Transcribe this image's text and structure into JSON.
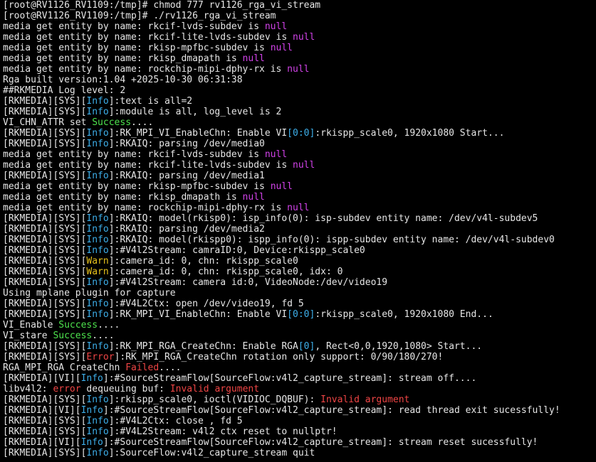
{
  "colors": {
    "background": "#000000",
    "text": "#e6e6e6",
    "info": "#3daee9",
    "null": "#d142e8",
    "success": "#4ee44e",
    "warn": "#e5c01c",
    "error": "#ef4545"
  },
  "lines": [
    [
      {
        "t": "[root@RV1126_RV1109:/tmp]# chmod 777 rv1126_rga_vi_stream"
      }
    ],
    [
      {
        "t": "[root@RV1126_RV1109:/tmp]# ./rv1126_rga_vi_stream"
      }
    ],
    [
      {
        "t": "media get entity by name: rkcif-lvds-subdev is "
      },
      {
        "t": "null",
        "c": "magenta"
      }
    ],
    [
      {
        "t": "media get entity by name: rkcif-lite-lvds-subdev is "
      },
      {
        "t": "null",
        "c": "magenta"
      }
    ],
    [
      {
        "t": "media get entity by name: rkisp-mpfbc-subdev is "
      },
      {
        "t": "null",
        "c": "magenta"
      }
    ],
    [
      {
        "t": "media get entity by name: rkisp_dmapath is "
      },
      {
        "t": "null",
        "c": "magenta"
      }
    ],
    [
      {
        "t": "media get entity by name: rockchip-mipi-dphy-rx is "
      },
      {
        "t": "null",
        "c": "magenta"
      }
    ],
    [
      {
        "t": "Rga built version:1.04 +2025-10-30 06:31:38"
      }
    ],
    [
      {
        "t": "##RKMEDIA Log level: 2"
      }
    ],
    [
      {
        "t": "[RKMEDIA][SYS]["
      },
      {
        "t": "Info",
        "c": "cyan"
      },
      {
        "t": "]:text is all=2"
      }
    ],
    [
      {
        "t": "[RKMEDIA][SYS]["
      },
      {
        "t": "Info",
        "c": "cyan"
      },
      {
        "t": "]:module is all, log_level is 2"
      }
    ],
    [
      {
        "t": "VI_CHN_ATTR set "
      },
      {
        "t": "Success",
        "c": "green"
      },
      {
        "t": "...."
      }
    ],
    [
      {
        "t": "[RKMEDIA][SYS]["
      },
      {
        "t": "Info",
        "c": "cyan"
      },
      {
        "t": "]:RK_MPI_VI_EnableChn: Enable VI"
      },
      {
        "t": "[0:0]",
        "c": "cyan"
      },
      {
        "t": ":rkispp_scale0, 1920x1080 Start..."
      }
    ],
    [
      {
        "t": "[RKMEDIA][SYS]["
      },
      {
        "t": "Info",
        "c": "cyan"
      },
      {
        "t": "]:RKAIQ: parsing /dev/media0"
      }
    ],
    [
      {
        "t": "media get entity by name: rkcif-lvds-subdev is "
      },
      {
        "t": "null",
        "c": "magenta"
      }
    ],
    [
      {
        "t": "media get entity by name: rkcif-lite-lvds-subdev is "
      },
      {
        "t": "null",
        "c": "magenta"
      }
    ],
    [
      {
        "t": "[RKMEDIA][SYS]["
      },
      {
        "t": "Info",
        "c": "cyan"
      },
      {
        "t": "]:RKAIQ: parsing /dev/media1"
      }
    ],
    [
      {
        "t": "media get entity by name: rkisp-mpfbc-subdev is "
      },
      {
        "t": "null",
        "c": "magenta"
      }
    ],
    [
      {
        "t": "media get entity by name: rkisp_dmapath is "
      },
      {
        "t": "null",
        "c": "magenta"
      }
    ],
    [
      {
        "t": "media get entity by name: rockchip-mipi-dphy-rx is "
      },
      {
        "t": "null",
        "c": "magenta"
      }
    ],
    [
      {
        "t": "[RKMEDIA][SYS]["
      },
      {
        "t": "Info",
        "c": "cyan"
      },
      {
        "t": "]:RKAIQ: model(rkisp0): isp_info(0): isp-subdev entity name: /dev/v4l-subdev5"
      }
    ],
    [
      {
        "t": "[RKMEDIA][SYS]["
      },
      {
        "t": "Info",
        "c": "cyan"
      },
      {
        "t": "]:RKAIQ: parsing /dev/media2"
      }
    ],
    [
      {
        "t": "[RKMEDIA][SYS]["
      },
      {
        "t": "Info",
        "c": "cyan"
      },
      {
        "t": "]:RKAIQ: model(rkispp0): ispp_info(0): ispp-subdev entity name: /dev/v4l-subdev0"
      }
    ],
    [
      {
        "t": "[RKMEDIA][SYS]["
      },
      {
        "t": "Info",
        "c": "cyan"
      },
      {
        "t": "]:#V4l2Stream: camraID:0, Device:rkispp_scale0"
      }
    ],
    [
      {
        "t": "[RKMEDIA][SYS]["
      },
      {
        "t": "Warn",
        "c": "yellow"
      },
      {
        "t": "]:camera_id: 0, chn: rkispp_scale0"
      }
    ],
    [
      {
        "t": "[RKMEDIA][SYS]["
      },
      {
        "t": "Warn",
        "c": "yellow"
      },
      {
        "t": "]:camera_id: 0, chn: rkispp_scale0, idx: 0"
      }
    ],
    [
      {
        "t": "[RKMEDIA][SYS]["
      },
      {
        "t": "Info",
        "c": "cyan"
      },
      {
        "t": "]:#V4l2Stream: camera id:0, VideoNode:/dev/video19"
      }
    ],
    [
      {
        "t": "Using mplane plugin for capture"
      }
    ],
    [
      {
        "t": "[RKMEDIA][SYS]["
      },
      {
        "t": "Info",
        "c": "cyan"
      },
      {
        "t": "]:#V4L2Ctx: open /dev/video19, fd 5"
      }
    ],
    [
      {
        "t": "[RKMEDIA][SYS]["
      },
      {
        "t": "Info",
        "c": "cyan"
      },
      {
        "t": "]:RK_MPI_VI_EnableChn: Enable VI"
      },
      {
        "t": "[0:0]",
        "c": "cyan"
      },
      {
        "t": ":rkispp_scale0, 1920x1080 End..."
      }
    ],
    [
      {
        "t": "VI_Enable "
      },
      {
        "t": "Success",
        "c": "green"
      },
      {
        "t": "...."
      }
    ],
    [
      {
        "t": "VI_stare "
      },
      {
        "t": "Success",
        "c": "green"
      },
      {
        "t": "...."
      }
    ],
    [
      {
        "t": "[RKMEDIA][SYS]["
      },
      {
        "t": "Info",
        "c": "cyan"
      },
      {
        "t": "]:RK_MPI_RGA_CreateChn: Enable RGA"
      },
      {
        "t": "[0]",
        "c": "cyan"
      },
      {
        "t": ", Rect<0,0,1920,1080> Start..."
      }
    ],
    [
      {
        "t": "[RKMEDIA][SYS]["
      },
      {
        "t": "Error",
        "c": "red"
      },
      {
        "t": "]:RK_MPI_RGA_CreateChn rotation only support: 0/90/180/270!"
      }
    ],
    [
      {
        "t": "RGA_MPI_RGA CreateChn "
      },
      {
        "t": "Failed",
        "c": "red"
      },
      {
        "t": "...."
      }
    ],
    [
      {
        "t": "[RKMEDIA][VI]["
      },
      {
        "t": "Info",
        "c": "cyan"
      },
      {
        "t": "]:#SourceStreamFlow[SourceFlow:v4l2_capture_stream]: stream off...."
      }
    ],
    [
      {
        "t": "libv4l2: "
      },
      {
        "t": "error",
        "c": "red"
      },
      {
        "t": " dequeuing buf: "
      },
      {
        "t": "Invalid argument",
        "c": "red"
      }
    ],
    [
      {
        "t": "[RKMEDIA][SYS]["
      },
      {
        "t": "Info",
        "c": "cyan"
      },
      {
        "t": "]:rkispp_scale0, ioctl(VIDIOC_DQBUF): "
      },
      {
        "t": "Invalid argument",
        "c": "red"
      }
    ],
    [
      {
        "t": "[RKMEDIA][VI]["
      },
      {
        "t": "Info",
        "c": "cyan"
      },
      {
        "t": "]:#SourceStreamFlow[SourceFlow:v4l2_capture_stream]: read thread exit sucessfully!"
      }
    ],
    [
      {
        "t": "[RKMEDIA][SYS]["
      },
      {
        "t": "Info",
        "c": "cyan"
      },
      {
        "t": "]:#V4L2Ctx: close , fd 5"
      }
    ],
    [
      {
        "t": "[RKMEDIA][SYS]["
      },
      {
        "t": "Info",
        "c": "cyan"
      },
      {
        "t": "]:#V4L2Stream: v4l2 ctx reset to nullptr!"
      }
    ],
    [
      {
        "t": "[RKMEDIA][VI]["
      },
      {
        "t": "Info",
        "c": "cyan"
      },
      {
        "t": "]:#SourceStreamFlow[SourceFlow:v4l2_capture_stream]: stream reset sucessfully!"
      }
    ],
    [
      {
        "t": "[RKMEDIA][SYS]["
      },
      {
        "t": "Info",
        "c": "cyan"
      },
      {
        "t": "]:SourceFlow:v4l2_capture_stream quit"
      }
    ]
  ]
}
